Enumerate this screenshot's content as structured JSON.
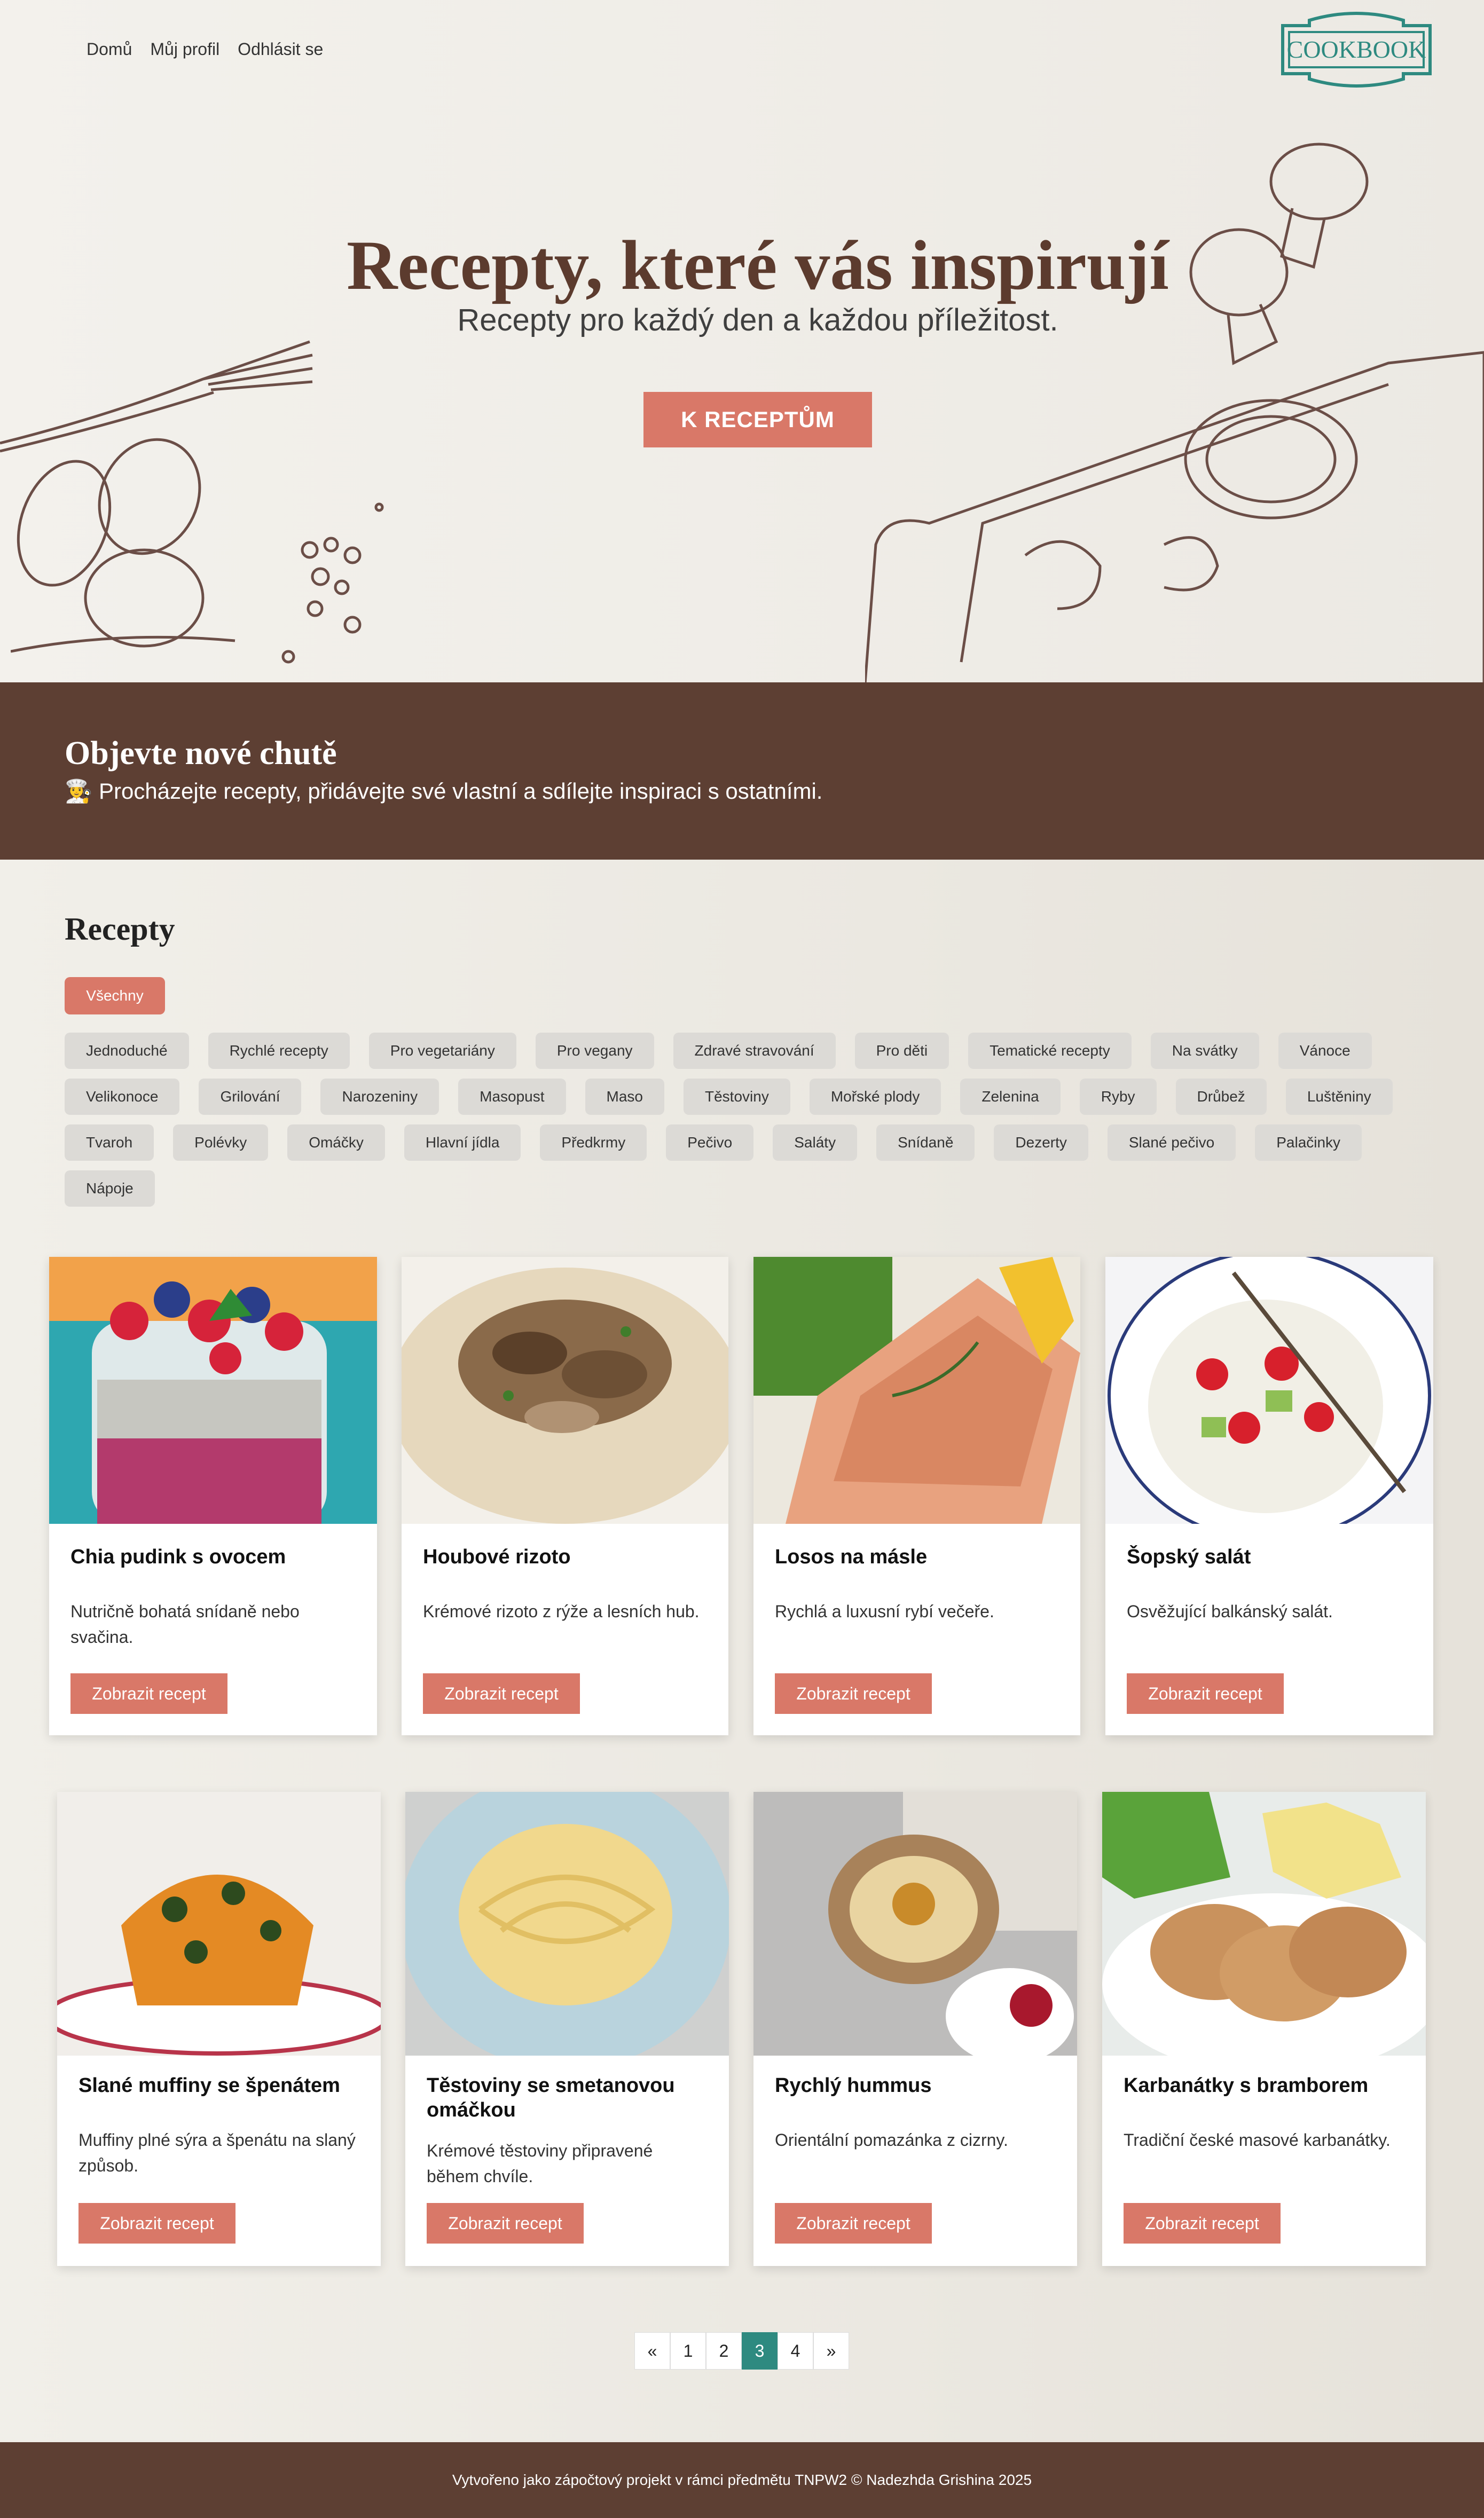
{
  "nav": {
    "home": "Domů",
    "profile": "Můj profil",
    "logout": "Odhlásit se"
  },
  "logo": {
    "text": "COOKBOOK"
  },
  "hero": {
    "title": "Recepty, které vás inspirují",
    "subtitle": "Recepty pro každý den a každou příležitost.",
    "cta": "K RECEPTŮM"
  },
  "band": {
    "title": "Objevte nové chutě",
    "text": "👩‍🍳 Procházejte recepty, přidávejte své vlastní a sdílejte inspiraci s ostatními."
  },
  "recipes": {
    "title": "Recepty",
    "all_filter": "Všechny",
    "filters": [
      "Jednoduché",
      "Rychlé recepty",
      "Pro vegetariány",
      "Pro vegany",
      "Zdravé stravování",
      "Pro děti",
      "Tematické recepty",
      "Na svátky",
      "Vánoce",
      "Velikonoce",
      "Grilování",
      "Narozeniny",
      "Masopust",
      "Maso",
      "Těstoviny",
      "Mořské plody",
      "Zelenina",
      "Ryby",
      "Drůbež",
      "Luštěniny",
      "Tvaroh",
      "Polévky",
      "Omáčky",
      "Hlavní jídla",
      "Předkrmy",
      "Pečivo",
      "Saláty",
      "Snídaně",
      "Dezerty",
      "Slané pečivo",
      "Palačinky",
      "Nápoje"
    ],
    "button_label": "Zobrazit recept",
    "cards": [
      {
        "title": "Chia pudink s ovocem",
        "desc": "Nutričně bohatá snídaně nebo svačina."
      },
      {
        "title": "Houbové rizoto",
        "desc": "Krémové rizoto z rýže a lesních hub."
      },
      {
        "title": "Losos na másle",
        "desc": "Rychlá a luxusní rybí večeře."
      },
      {
        "title": "Šopský salát",
        "desc": "Osvěžující balkánský salát."
      },
      {
        "title": "Slané muffiny se špenátem",
        "desc": "Muffiny plné sýra a špenátu na slaný způsob."
      },
      {
        "title": "Těstoviny se smetanovou omáčkou",
        "desc": "Krémové těstoviny připravené během chvíle."
      },
      {
        "title": "Rychlý hummus",
        "desc": "Orientální pomazánka z cizrny."
      },
      {
        "title": "Karbanátky s bramborem",
        "desc": "Tradiční české masové karbanátky."
      }
    ]
  },
  "pagination": {
    "prev": "«",
    "pages": [
      "1",
      "2",
      "3",
      "4"
    ],
    "active": "3",
    "next": "»"
  },
  "footer": {
    "text": "Vytvořeno jako zápočtový projekt v rámci předmětu TNPW2 © Nadezhda Grishina 2025"
  },
  "colors": {
    "accent": "#d97868",
    "brown": "#5d3f33",
    "teal": "#2e8a80"
  }
}
